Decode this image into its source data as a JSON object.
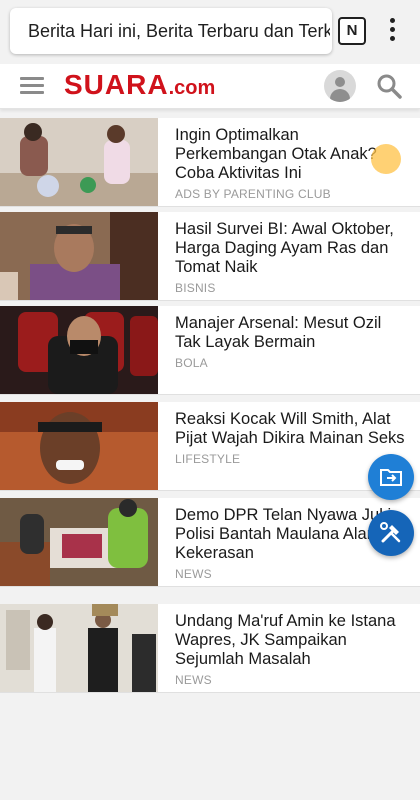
{
  "browser": {
    "url_text": "Berita Hari ini, Berita Terbaru dan Terkini",
    "tab_switch_label": "N"
  },
  "header": {
    "logo_main": "SUARA",
    "logo_suffix": ".com"
  },
  "articles": [
    {
      "title": "Ingin Optimalkan Perkembangan Otak Anak? Coba Aktivitas Ini",
      "category": "ADS BY PARENTING CLUB"
    },
    {
      "title": "Hasil Survei BI: Awal Oktober, Harga Daging Ayam Ras dan Tomat Naik",
      "category": "BISNIS"
    },
    {
      "title": "Manajer Arsenal: Mesut Ozil Tak Layak Bermain",
      "category": "BOLA"
    },
    {
      "title": "Reaksi Kocak Will Smith, Alat Pijat Wajah Dikira Mainan Seks",
      "category": "LIFESTYLE"
    },
    {
      "title": "Demo DPR Telan Nyawa Jukir, Polisi Bantah Maulana Alami Kekerasan",
      "category": "NEWS"
    },
    {
      "title": "Undang Ma'ruf Amin ke Istana Wapres, JK Sampaikan Sejumlah Masalah",
      "category": "NEWS"
    }
  ],
  "colors": {
    "brand_red": "#d0121b",
    "fab_blue": "#1f7fd6"
  }
}
